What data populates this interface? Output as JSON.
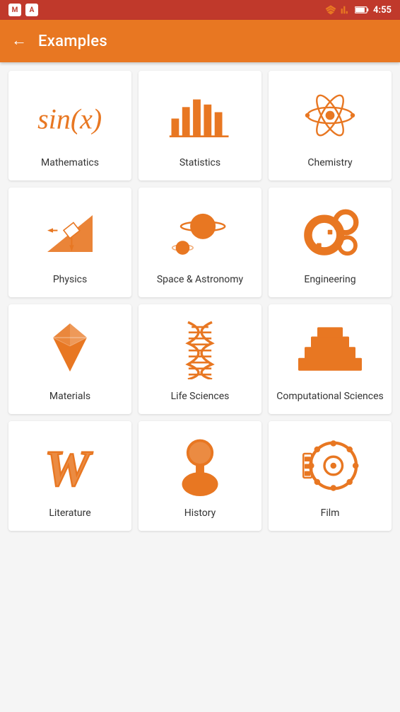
{
  "statusBar": {
    "time": "4:55",
    "icons": [
      "signal",
      "wifi",
      "battery"
    ]
  },
  "header": {
    "back_label": "←",
    "title": "Examples"
  },
  "cards": [
    {
      "id": "mathematics",
      "label": "Mathematics",
      "icon": "math"
    },
    {
      "id": "statistics",
      "label": "Statistics",
      "icon": "statistics"
    },
    {
      "id": "chemistry",
      "label": "Chemistry",
      "icon": "chemistry"
    },
    {
      "id": "physics",
      "label": "Physics",
      "icon": "physics"
    },
    {
      "id": "space-astronomy",
      "label": "Space & Astronomy",
      "icon": "space"
    },
    {
      "id": "engineering",
      "label": "Engineering",
      "icon": "engineering"
    },
    {
      "id": "materials",
      "label": "Materials",
      "icon": "materials"
    },
    {
      "id": "life-sciences",
      "label": "Life Sciences",
      "icon": "life-sciences"
    },
    {
      "id": "computational-sciences",
      "label": "Computational Sciences",
      "icon": "computational"
    },
    {
      "id": "literature",
      "label": "Literature",
      "icon": "literature"
    },
    {
      "id": "history",
      "label": "History",
      "icon": "history"
    },
    {
      "id": "film",
      "label": "Film",
      "icon": "film"
    }
  ],
  "accent_color": "#e87722"
}
